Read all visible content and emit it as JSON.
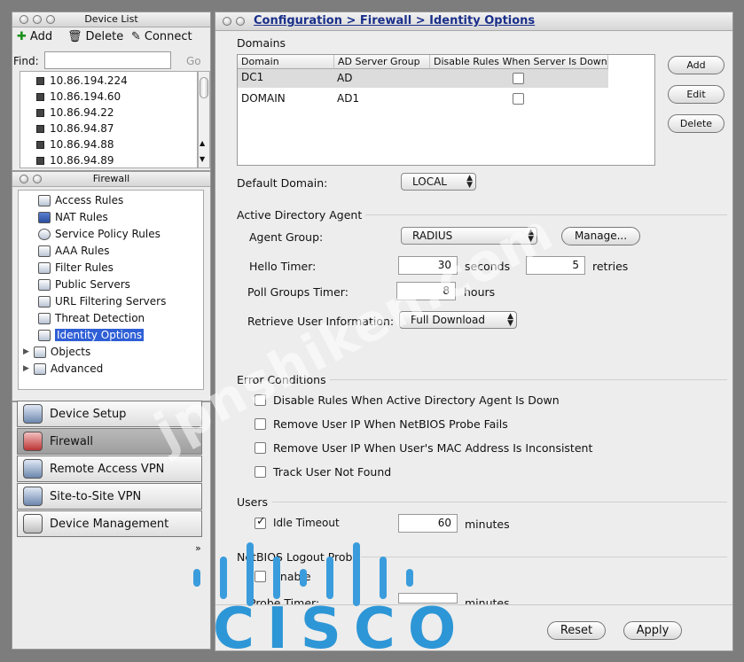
{
  "device_list": {
    "title": "Device List",
    "toolbar": {
      "add": "Add",
      "delete": "Delete",
      "connect": "Connect"
    },
    "find_label": "Find:",
    "find_value": "",
    "go_label": "Go",
    "devices": [
      "10.86.194.224",
      "10.86.194.60",
      "10.86.94.22",
      "10.86.94.87",
      "10.86.94.88",
      "10.86.94.89"
    ]
  },
  "firewall_panel": {
    "title": "Firewall",
    "items": [
      "Access Rules",
      "NAT Rules",
      "Service Policy Rules",
      "AAA Rules",
      "Filter Rules",
      "Public Servers",
      "URL Filtering Servers",
      "Threat Detection",
      "Identity Options",
      "Objects",
      "Advanced"
    ],
    "selected": "Identity Options"
  },
  "nav": {
    "device_setup": "Device Setup",
    "firewall": "Firewall",
    "remote_access_vpn": "Remote Access VPN",
    "site_to_site_vpn": "Site-to-Site VPN",
    "device_management": "Device Management"
  },
  "content": {
    "breadcrumb": "Configuration > Firewall > Identity Options",
    "domains_label": "Domains",
    "table": {
      "columns": [
        "Domain",
        "AD Server Group",
        "Disable Rules When Server Is Down"
      ],
      "rows": [
        {
          "domain": "DC1",
          "group": "AD",
          "disable": false
        },
        {
          "domain": "DOMAIN",
          "group": "AD1",
          "disable": false
        }
      ]
    },
    "buttons": {
      "add": "Add",
      "edit": "Edit",
      "delete": "Delete",
      "manage": "Manage...",
      "reset": "Reset",
      "apply": "Apply"
    },
    "default_domain_label": "Default Domain:",
    "default_domain_value": "LOCAL",
    "ad_agent_label": "Active Directory Agent",
    "agent_group_label": "Agent Group:",
    "agent_group_value": "RADIUS",
    "hello_timer_label": "Hello Timer:",
    "hello_timer_value": "30",
    "seconds_label": "seconds",
    "retries_value": "5",
    "retries_label": "retries",
    "poll_groups_label": "Poll Groups Timer:",
    "poll_groups_value": "8",
    "hours_label": "hours",
    "retrieve_label": "Retrieve User Information:",
    "retrieve_value": "Full Download",
    "error_conditions_label": "Error Conditions",
    "error_conditions": [
      {
        "label": "Disable Rules When Active Directory Agent Is Down",
        "checked": false
      },
      {
        "label": "Remove User IP When NetBIOS Probe Fails",
        "checked": false
      },
      {
        "label": "Remove User IP When User's MAC Address Is Inconsistent",
        "checked": false
      },
      {
        "label": "Track User Not Found",
        "checked": false
      }
    ],
    "users_label": "Users",
    "idle_timeout_label": "Idle Timeout",
    "idle_timeout_checked": true,
    "idle_timeout_value": "60",
    "minutes_label": "minutes",
    "netbios_label": "NetBIOS Logout Probe",
    "enable_label": "Enable",
    "probe_timer_label": "Probe Timer:",
    "probe_minutes_label": "minutes"
  },
  "overlay": {
    "watermark": "jpnshiken.com",
    "logo": "CISCO"
  }
}
